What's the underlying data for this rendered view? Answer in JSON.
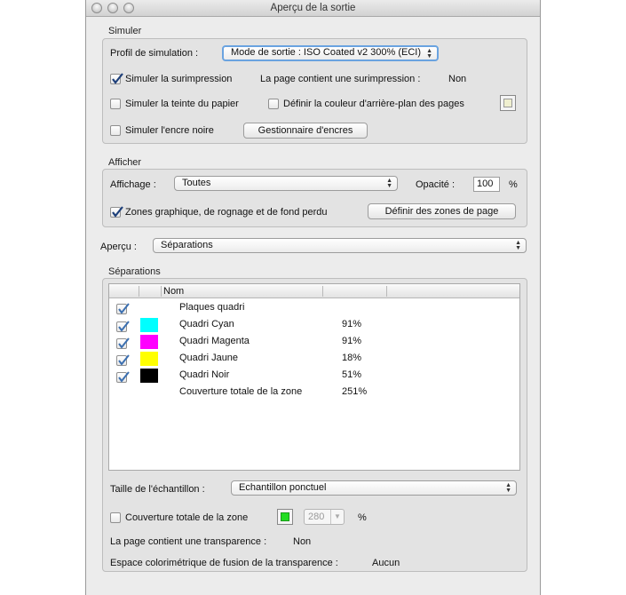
{
  "window": {
    "title": "Aperçu de la sortie"
  },
  "simuler": {
    "section_label": "Simuler",
    "profile_label": "Profil de simulation :",
    "profile_value": "Mode de sortie : ISO Coated v2 300% (ECI)",
    "overprint_label": "Simuler la surimpression",
    "overprint_checked": true,
    "overprint_status_label": "La page contient une surimpression :",
    "overprint_status_value": "Non",
    "paper_label": "Simuler la teinte du papier",
    "paper_checked": false,
    "bg_color_label": "Définir la couleur d'arrière-plan des pages",
    "bg_color_checked": false,
    "bg_color_swatch": "#efefcf",
    "black_ink_label": "Simuler l'encre noire",
    "black_ink_checked": false,
    "ink_manager_button": "Gestionnaire d'encres"
  },
  "afficher": {
    "section_label": "Afficher",
    "display_label": "Affichage :",
    "display_value": "Toutes",
    "opacity_label": "Opacité :",
    "opacity_value": "100",
    "opacity_unit": "%",
    "zones_label": "Zones graphique, de rognage et de fond perdu",
    "zones_checked": true,
    "define_zones_button": "Définir des zones de page"
  },
  "apercu": {
    "label": "Aperçu :",
    "value": "Séparations"
  },
  "separations": {
    "section_label": "Séparations",
    "column_name": "Nom",
    "rows": [
      {
        "name": "Plaques quadri",
        "checked": true,
        "color": "",
        "value": ""
      },
      {
        "name": "Quadri Cyan",
        "checked": true,
        "color": "#00ffff",
        "value": "91%"
      },
      {
        "name": "Quadri Magenta",
        "checked": true,
        "color": "#ff00ff",
        "value": "91%"
      },
      {
        "name": "Quadri Jaune",
        "checked": true,
        "color": "#ffff00",
        "value": "18%"
      },
      {
        "name": "Quadri Noir",
        "checked": true,
        "color": "#000000",
        "value": "51%"
      },
      {
        "name": "Couverture totale de la zone",
        "checked": false,
        "color": "",
        "value": "251%"
      }
    ],
    "sample_size_label": "Taille de l'échantillon :",
    "sample_size_value": "Echantillon ponctuel",
    "total_coverage_label": "Couverture totale de la zone",
    "total_coverage_checked": false,
    "total_coverage_color": "#22dd22",
    "total_coverage_value": "280",
    "total_coverage_unit": "%",
    "transparency_label": "La page contient une transparence :",
    "transparency_value": "Non",
    "blend_space_label": "Espace colorimétrique de fusion de la transparence :",
    "blend_space_value": "Aucun"
  }
}
